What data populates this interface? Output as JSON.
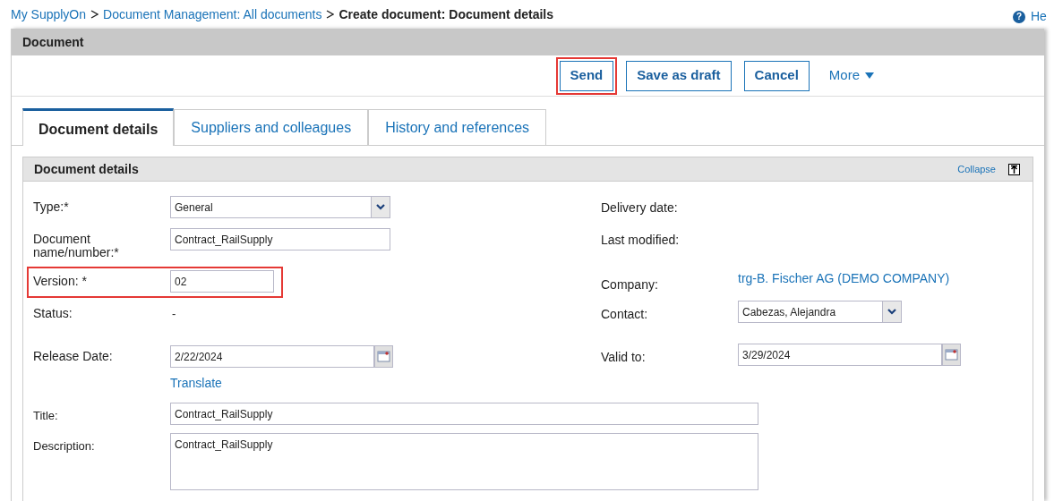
{
  "breadcrumb": [
    {
      "text": "My SupplyOn",
      "kind": "link"
    },
    {
      "text": "Document Management: All documents",
      "kind": "link"
    },
    {
      "text": "Create document: Document details",
      "kind": "current"
    }
  ],
  "help_icon": "?",
  "help": "He",
  "panel_title": "Document",
  "toolbar": {
    "buttons": [
      {
        "label": "Send",
        "highlighted": true
      },
      {
        "label": "Save as draft",
        "highlighted": false
      },
      {
        "label": "Cancel",
        "highlighted": false
      }
    ],
    "more": "More"
  },
  "tabs": [
    {
      "label": "Document details",
      "selected": true
    },
    {
      "label": "Suppliers and colleagues",
      "selected": false
    },
    {
      "label": "History and references",
      "selected": false
    }
  ],
  "section": {
    "title": "Document details",
    "collapse": "Collapse"
  },
  "rows": [
    {
      "left": {
        "label": "Type:*",
        "kind": "select",
        "value": "General",
        "highlighted": false
      },
      "right": {
        "label": "Delivery date:",
        "kind": "empty"
      }
    },
    {
      "left": {
        "label": "Document name/number:*",
        "kind": "text",
        "value": "Contract_RailSupply",
        "highlighted": false
      },
      "right": {
        "label": "Last modified:",
        "kind": "empty"
      }
    },
    {
      "left": {
        "label": "Version: *",
        "kind": "short_text",
        "value": "02",
        "highlighted": true
      },
      "right": {
        "label": "Company:",
        "kind": "link",
        "value": "trg-B. Fischer AG (DEMO COMPANY)"
      }
    },
    {
      "left": {
        "label": "Status:",
        "kind": "static",
        "value": "-",
        "highlighted": false
      },
      "right": {
        "label": "Contact:",
        "kind": "select",
        "value": "Cabezas, Alejandra"
      }
    },
    {
      "left": {
        "label": "Release Date:",
        "kind": "date",
        "value": "2/22/2024",
        "highlighted": false
      },
      "right": {
        "label": "Valid to:",
        "kind": "date",
        "value": "3/29/2024"
      }
    }
  ],
  "translate": "Translate",
  "title_field": {
    "label": "Title:",
    "value": "Contract_RailSupply"
  },
  "description_field": {
    "label": "Description:",
    "value": "Contract_RailSupply"
  }
}
